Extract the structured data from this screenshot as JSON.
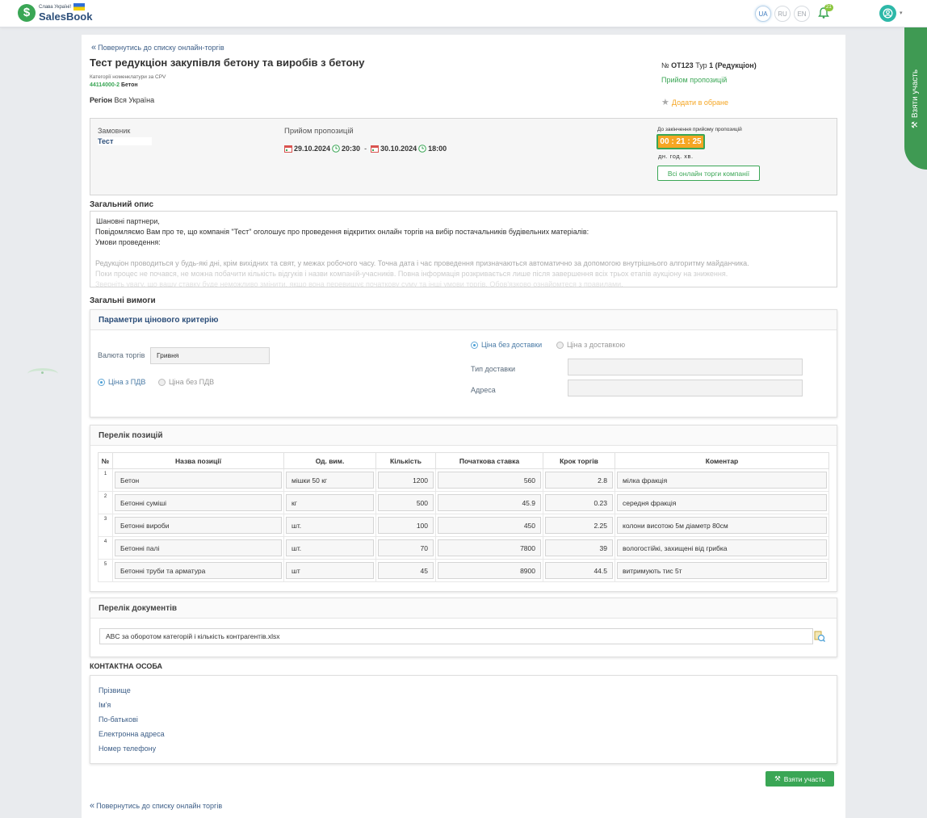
{
  "header": {
    "slogan": "Слава Україні!",
    "logo_name": "SalesBook",
    "langs": [
      "UA",
      "RU",
      "EN"
    ],
    "notif_count": "21"
  },
  "side_tab": {
    "label": "Взяти участь"
  },
  "back_link": "Повернутись до списку онлайн-торгів",
  "back_link_bottom": "Повернутись до списку онлайн торгів",
  "title": "Тест редукціон закупівля бетону та виробів з бетону",
  "cpv_label": "Категорії номенклатури за CPV",
  "cpv_code": "44114000-2",
  "cpv_name": "Бетон",
  "region_label": "Регіон",
  "region_value": "Вся Україна",
  "meta": {
    "no_label": "№",
    "no_value": "OT123",
    "type_label": "Тур",
    "type_value": "1 (Редукціон)",
    "status": "Прийом пропозицій",
    "favorite": "Додати в обране"
  },
  "info": {
    "customer_label": "Замовник",
    "customer_value": "Тест",
    "reception_label": "Прийом пропозицій",
    "date_from": "29.10.2024",
    "time_from": "20:30",
    "date_sep": "-",
    "date_to": "30.10.2024",
    "time_to": "18:00",
    "countdown_label": "До закінчення прийому пропозицій",
    "countdown": "00 : 21 : 25",
    "countdown_units": "дн. год. хв.",
    "all_tenders_button": "Всі онлайн торги компанії"
  },
  "description": {
    "heading": "Загальний опис",
    "lines": [
      "Шановні партнери,",
      "Повідомляємо Вам про те, що компанія \"Тест\" оголошує про проведення відкритих онлайн торгів  на вибір постачальників будівельних матеріалів:",
      "Умови проведення:",
      "",
      "Редукціон проводиться у будь-які дні, крім вихідних та свят, у межах робочого часу. Точна дата і час проведення призначаються автоматично за допомогою внутрішнього алгоритму майданчика.",
      "Поки процес не почався, не можна побачити кількість відгуків і назви компаній-учасників. Повна інформація розкривається лише після завершення всіх трьох етапів аукціону на зниження.",
      "Зверніть увагу, що вашу ставку буде неможливо змінити, якщо вона перевищує початкову суму та інші умови торгів. Обов'язково ознайомтеся з правилами."
    ]
  },
  "general_requirements": "Загальні вимоги",
  "price_criteria": {
    "heading": "Параметри цінового критерію",
    "currency_label": "Валюта торгів",
    "currency_value": "Гривня",
    "vat_on": "Ціна з ПДВ",
    "vat_off": "Ціна без ПДВ",
    "delivery_off": "Ціна без доставки",
    "delivery_on": "Ціна з доставкою",
    "delivery_type_label": "Тип доставки",
    "address_label": "Адреса"
  },
  "positions": {
    "heading": "Перелік позицій",
    "columns": [
      "№",
      "Назва позиції",
      "Од. вим.",
      "Кількість",
      "Початкова ставка",
      "Крок торгів",
      "Коментар"
    ],
    "rows": [
      {
        "n": "1",
        "name": "Бетон",
        "unit": "мішки 50 кг",
        "qty": "1200",
        "start": "560",
        "step": "2.8",
        "comment": "мілка фракція"
      },
      {
        "n": "2",
        "name": "Бетонні суміші",
        "unit": "кг",
        "qty": "500",
        "start": "45.9",
        "step": "0.23",
        "comment": "середня фракція"
      },
      {
        "n": "3",
        "name": "Бетонні вироби",
        "unit": "шт.",
        "qty": "100",
        "start": "450",
        "step": "2.25",
        "comment": "колони висотою 5м діаметр 80см"
      },
      {
        "n": "4",
        "name": "Бетонні палі",
        "unit": "шт.",
        "qty": "70",
        "start": "7800",
        "step": "39",
        "comment": "вологостійкі, захищені від грибка"
      },
      {
        "n": "5",
        "name": "Бетонні труби та арматура",
        "unit": "шт",
        "qty": "45",
        "start": "8900",
        "step": "44.5",
        "comment": "витримують тис 5т"
      }
    ]
  },
  "documents": {
    "heading": "Перелік документів",
    "file": "ABC за оборотом категорій і кількість контрагентів.xlsx"
  },
  "contact": {
    "heading": "КОНТАКТНА ОСОБА",
    "fields": [
      "Прізвище",
      "Ім'я",
      "По-батькові",
      "Електронна адреса",
      "Номер телефону"
    ]
  },
  "participate_button": "Взяти участь",
  "colors": {
    "brand_green": "#3aa655",
    "timer_orange": "#f5a623",
    "link_blue": "#3e5f88"
  }
}
